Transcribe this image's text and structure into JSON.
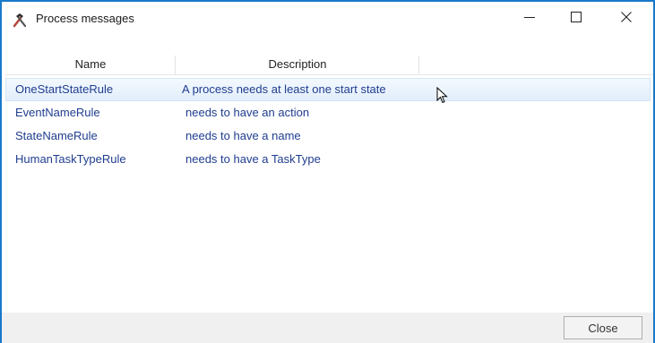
{
  "window": {
    "title": "Process messages",
    "icon": "hammer-tools-icon",
    "accent_color": "#1979ca"
  },
  "table": {
    "columns": [
      "Name",
      "Description"
    ],
    "rows": [
      {
        "name": "OneStartStateRule",
        "description": "A process needs at least one start state",
        "selected": true
      },
      {
        "name": "EventNameRule",
        "description": "needs to have an action",
        "selected": false
      },
      {
        "name": "StateNameRule",
        "description": "needs to have a name",
        "selected": false
      },
      {
        "name": "HumanTaskTypeRule",
        "description": "needs to have a TaskType",
        "selected": false
      }
    ],
    "text_color": "#1f3d8f",
    "selected_row_color": "#e2eefb"
  },
  "footer": {
    "close_label": "Close"
  }
}
